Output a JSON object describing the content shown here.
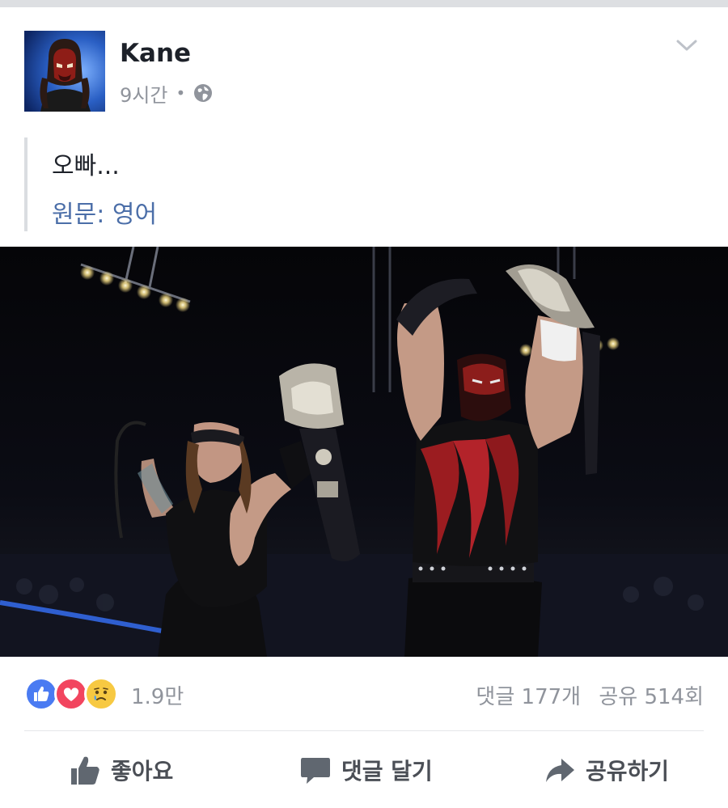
{
  "post": {
    "author": "Kane",
    "timestamp": "9시간",
    "separator": "•",
    "privacy_icon": "globe-icon",
    "message": "오빠...",
    "translation_label": "원문: 영어",
    "menu_icon": "chevron-down-icon"
  },
  "reactions": {
    "types": [
      "like-icon",
      "love-icon",
      "sad-icon"
    ],
    "count": "1.9만",
    "comments": "댓글 177개",
    "shares": "공유 514회"
  },
  "actions": {
    "like_label": "좋아요",
    "comment_label": "댓글 달기",
    "share_label": "공유하기"
  },
  "colors": {
    "like_blue": "#4a7bf2",
    "love_red": "#f2455f",
    "sad_yellow": "#f7c942",
    "link_blue": "#4b6ea8",
    "meta_grey": "#90949c"
  }
}
